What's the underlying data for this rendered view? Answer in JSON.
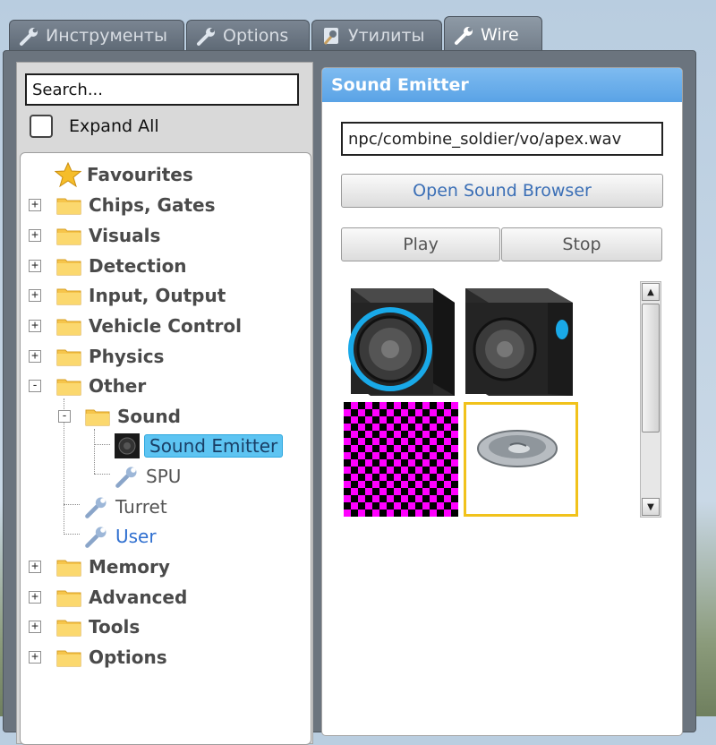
{
  "tabs": [
    {
      "label": "Инструменты",
      "icon": "wrench-icon"
    },
    {
      "label": "Options",
      "icon": "wrench-icon"
    },
    {
      "label": "Утилиты",
      "icon": "utilities-icon"
    },
    {
      "label": "Wire",
      "icon": "wrench-icon",
      "active": true
    }
  ],
  "sidebar": {
    "search_value": "Search...",
    "expand_all_label": "Expand All",
    "expand_all_checked": false,
    "tree": {
      "favourites": "Favourites",
      "chips_gates": "Chips, Gates",
      "visuals": "Visuals",
      "detection": "Detection",
      "input_output": "Input, Output",
      "vehicle_control": "Vehicle Control",
      "physics": "Physics",
      "other": "Other",
      "sound": "Sound",
      "sound_emitter": "Sound Emitter",
      "spu": "SPU",
      "turret": "Turret",
      "user": "User",
      "memory": "Memory",
      "advanced": "Advanced",
      "tools": "Tools",
      "options": "Options",
      "expanded_marker": "-",
      "collapsed_marker": "+"
    }
  },
  "panel": {
    "title": "Sound Emitter",
    "sound_path": "npc/combine_soldier/vo/apex.wav",
    "open_browser_label": "Open Sound Browser",
    "play_label": "Play",
    "stop_label": "Stop",
    "models": [
      {
        "name": "speaker-cube-blue-ring",
        "selected": false
      },
      {
        "name": "speaker-cube-blue-light",
        "selected": false
      },
      {
        "name": "missing-texture",
        "selected": false
      },
      {
        "name": "round-speaker",
        "selected": true
      }
    ]
  },
  "colors": {
    "accent_header": "#6aafea",
    "selection": "#5dc4f2",
    "selected_tile_border": "#f1c21b",
    "folder": "#f6c54b",
    "link_blue": "#2f6fd0"
  }
}
